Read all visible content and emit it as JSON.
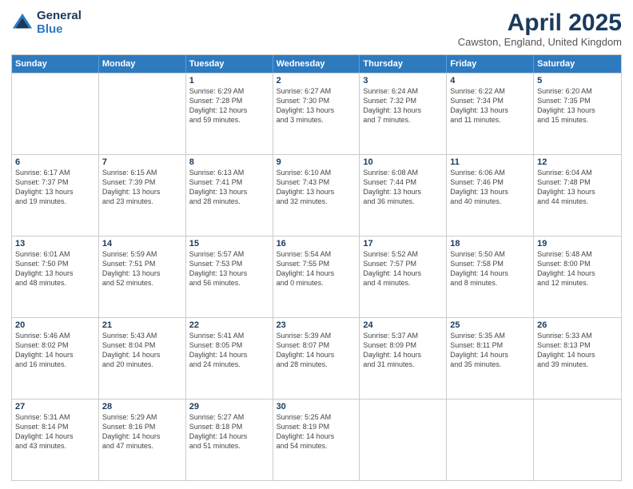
{
  "header": {
    "logo": {
      "general": "General",
      "blue": "Blue"
    },
    "title": "April 2025",
    "location": "Cawston, England, United Kingdom"
  },
  "calendar": {
    "weekdays": [
      "Sunday",
      "Monday",
      "Tuesday",
      "Wednesday",
      "Thursday",
      "Friday",
      "Saturday"
    ],
    "weeks": [
      [
        {
          "day": "",
          "info": ""
        },
        {
          "day": "",
          "info": ""
        },
        {
          "day": "1",
          "info": "Sunrise: 6:29 AM\nSunset: 7:28 PM\nDaylight: 12 hours\nand 59 minutes."
        },
        {
          "day": "2",
          "info": "Sunrise: 6:27 AM\nSunset: 7:30 PM\nDaylight: 13 hours\nand 3 minutes."
        },
        {
          "day": "3",
          "info": "Sunrise: 6:24 AM\nSunset: 7:32 PM\nDaylight: 13 hours\nand 7 minutes."
        },
        {
          "day": "4",
          "info": "Sunrise: 6:22 AM\nSunset: 7:34 PM\nDaylight: 13 hours\nand 11 minutes."
        },
        {
          "day": "5",
          "info": "Sunrise: 6:20 AM\nSunset: 7:35 PM\nDaylight: 13 hours\nand 15 minutes."
        }
      ],
      [
        {
          "day": "6",
          "info": "Sunrise: 6:17 AM\nSunset: 7:37 PM\nDaylight: 13 hours\nand 19 minutes."
        },
        {
          "day": "7",
          "info": "Sunrise: 6:15 AM\nSunset: 7:39 PM\nDaylight: 13 hours\nand 23 minutes."
        },
        {
          "day": "8",
          "info": "Sunrise: 6:13 AM\nSunset: 7:41 PM\nDaylight: 13 hours\nand 28 minutes."
        },
        {
          "day": "9",
          "info": "Sunrise: 6:10 AM\nSunset: 7:43 PM\nDaylight: 13 hours\nand 32 minutes."
        },
        {
          "day": "10",
          "info": "Sunrise: 6:08 AM\nSunset: 7:44 PM\nDaylight: 13 hours\nand 36 minutes."
        },
        {
          "day": "11",
          "info": "Sunrise: 6:06 AM\nSunset: 7:46 PM\nDaylight: 13 hours\nand 40 minutes."
        },
        {
          "day": "12",
          "info": "Sunrise: 6:04 AM\nSunset: 7:48 PM\nDaylight: 13 hours\nand 44 minutes."
        }
      ],
      [
        {
          "day": "13",
          "info": "Sunrise: 6:01 AM\nSunset: 7:50 PM\nDaylight: 13 hours\nand 48 minutes."
        },
        {
          "day": "14",
          "info": "Sunrise: 5:59 AM\nSunset: 7:51 PM\nDaylight: 13 hours\nand 52 minutes."
        },
        {
          "day": "15",
          "info": "Sunrise: 5:57 AM\nSunset: 7:53 PM\nDaylight: 13 hours\nand 56 minutes."
        },
        {
          "day": "16",
          "info": "Sunrise: 5:54 AM\nSunset: 7:55 PM\nDaylight: 14 hours\nand 0 minutes."
        },
        {
          "day": "17",
          "info": "Sunrise: 5:52 AM\nSunset: 7:57 PM\nDaylight: 14 hours\nand 4 minutes."
        },
        {
          "day": "18",
          "info": "Sunrise: 5:50 AM\nSunset: 7:58 PM\nDaylight: 14 hours\nand 8 minutes."
        },
        {
          "day": "19",
          "info": "Sunrise: 5:48 AM\nSunset: 8:00 PM\nDaylight: 14 hours\nand 12 minutes."
        }
      ],
      [
        {
          "day": "20",
          "info": "Sunrise: 5:46 AM\nSunset: 8:02 PM\nDaylight: 14 hours\nand 16 minutes."
        },
        {
          "day": "21",
          "info": "Sunrise: 5:43 AM\nSunset: 8:04 PM\nDaylight: 14 hours\nand 20 minutes."
        },
        {
          "day": "22",
          "info": "Sunrise: 5:41 AM\nSunset: 8:05 PM\nDaylight: 14 hours\nand 24 minutes."
        },
        {
          "day": "23",
          "info": "Sunrise: 5:39 AM\nSunset: 8:07 PM\nDaylight: 14 hours\nand 28 minutes."
        },
        {
          "day": "24",
          "info": "Sunrise: 5:37 AM\nSunset: 8:09 PM\nDaylight: 14 hours\nand 31 minutes."
        },
        {
          "day": "25",
          "info": "Sunrise: 5:35 AM\nSunset: 8:11 PM\nDaylight: 14 hours\nand 35 minutes."
        },
        {
          "day": "26",
          "info": "Sunrise: 5:33 AM\nSunset: 8:13 PM\nDaylight: 14 hours\nand 39 minutes."
        }
      ],
      [
        {
          "day": "27",
          "info": "Sunrise: 5:31 AM\nSunset: 8:14 PM\nDaylight: 14 hours\nand 43 minutes."
        },
        {
          "day": "28",
          "info": "Sunrise: 5:29 AM\nSunset: 8:16 PM\nDaylight: 14 hours\nand 47 minutes."
        },
        {
          "day": "29",
          "info": "Sunrise: 5:27 AM\nSunset: 8:18 PM\nDaylight: 14 hours\nand 51 minutes."
        },
        {
          "day": "30",
          "info": "Sunrise: 5:25 AM\nSunset: 8:19 PM\nDaylight: 14 hours\nand 54 minutes."
        },
        {
          "day": "",
          "info": ""
        },
        {
          "day": "",
          "info": ""
        },
        {
          "day": "",
          "info": ""
        }
      ]
    ]
  }
}
